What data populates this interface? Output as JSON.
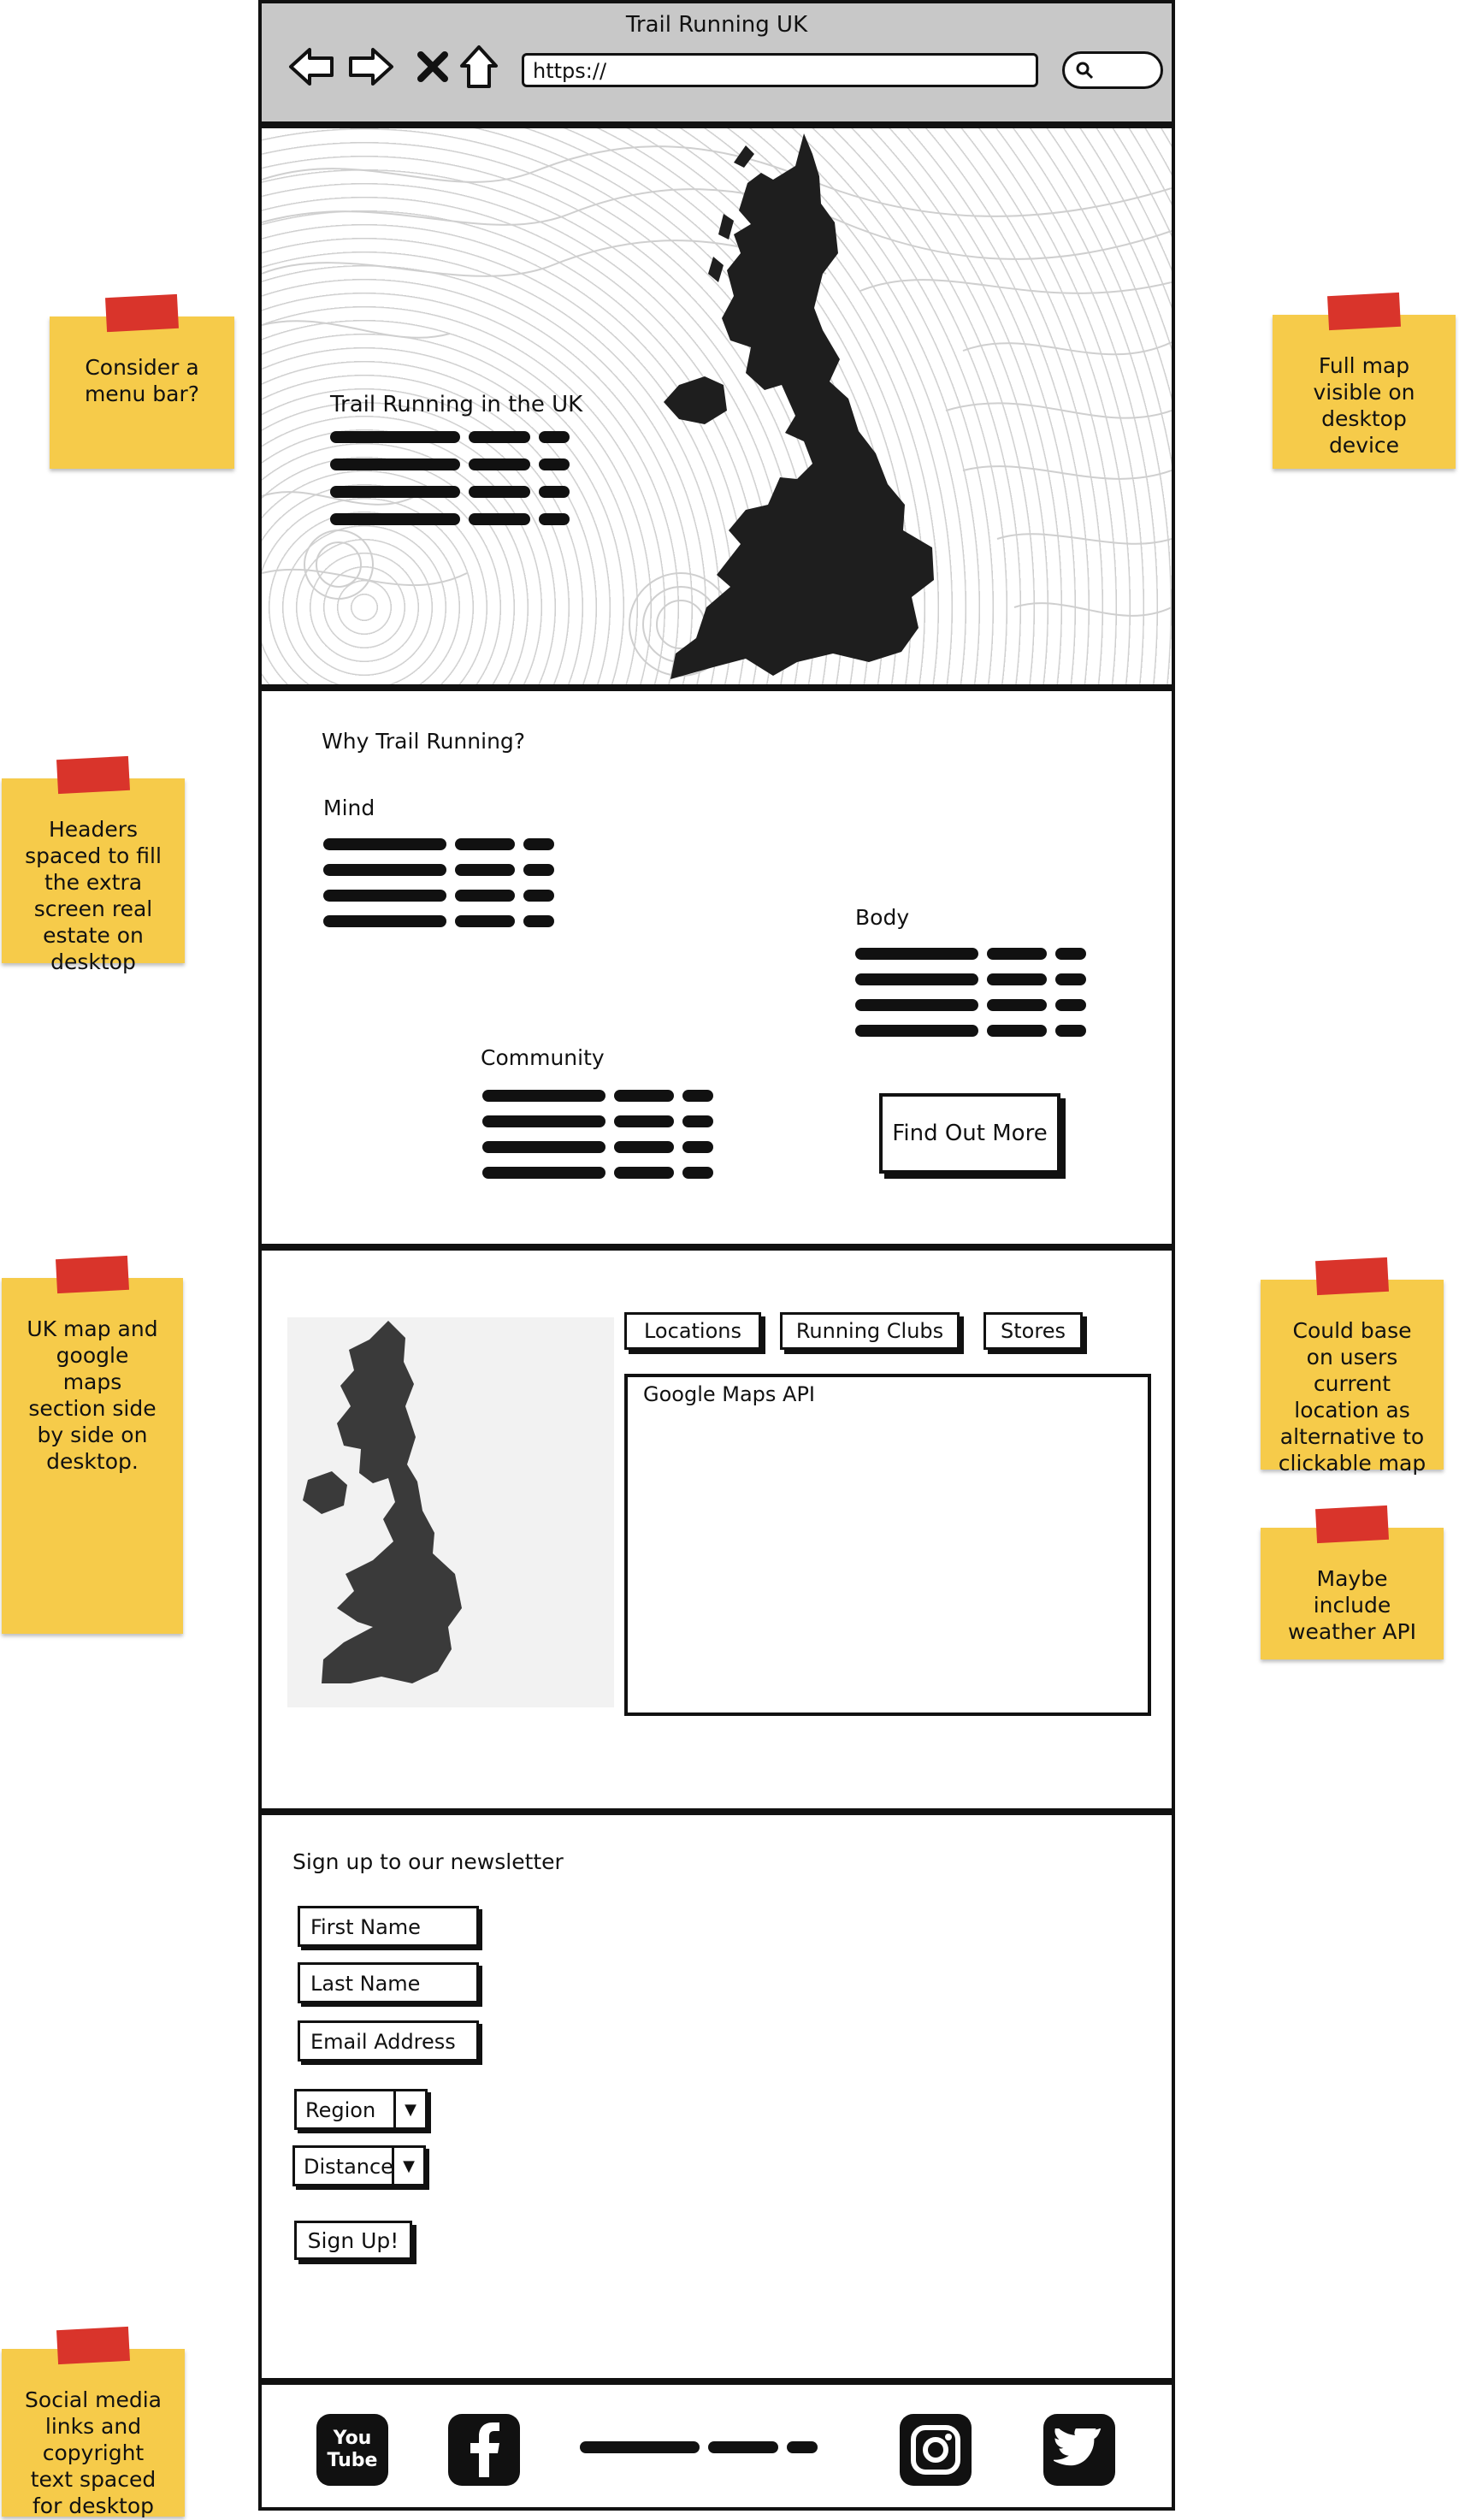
{
  "browser": {
    "title": "Trail Running UK",
    "url": "https://"
  },
  "hero": {
    "title": "Trail Running in the UK"
  },
  "why": {
    "title": "Why Trail Running?",
    "mind": "Mind",
    "body": "Body",
    "community": "Community",
    "button": "Find Out More"
  },
  "maps": {
    "tabs": [
      "Locations",
      "Running Clubs",
      "Stores"
    ],
    "api_label": "Google Maps API"
  },
  "newsletter": {
    "title": "Sign up to our newsletter",
    "first_name": "First Name",
    "last_name": "Last Name",
    "email": "Email Address",
    "region": "Region",
    "distance": "Distance",
    "signup": "Sign Up!"
  },
  "footer": {
    "icons": [
      "youtube-icon",
      "facebook-icon",
      "instagram-icon",
      "twitter-icon"
    ],
    "youtube_text": "You Tube"
  },
  "notes": [
    "Consider a menu bar?",
    "Full map visible on desktop device",
    "Headers spaced to fill the extra screen real estate on desktop",
    "UK map and google maps section side by side on desktop.",
    "Could base on users current location as alternative to clickable map",
    "Maybe include weather API",
    "Social media links and copyright text spaced for desktop"
  ],
  "colors": {
    "sticky_note": "#f6cb4a",
    "tape": "#d9342b",
    "chrome": "#c8c8c8",
    "ink": "#111111"
  }
}
